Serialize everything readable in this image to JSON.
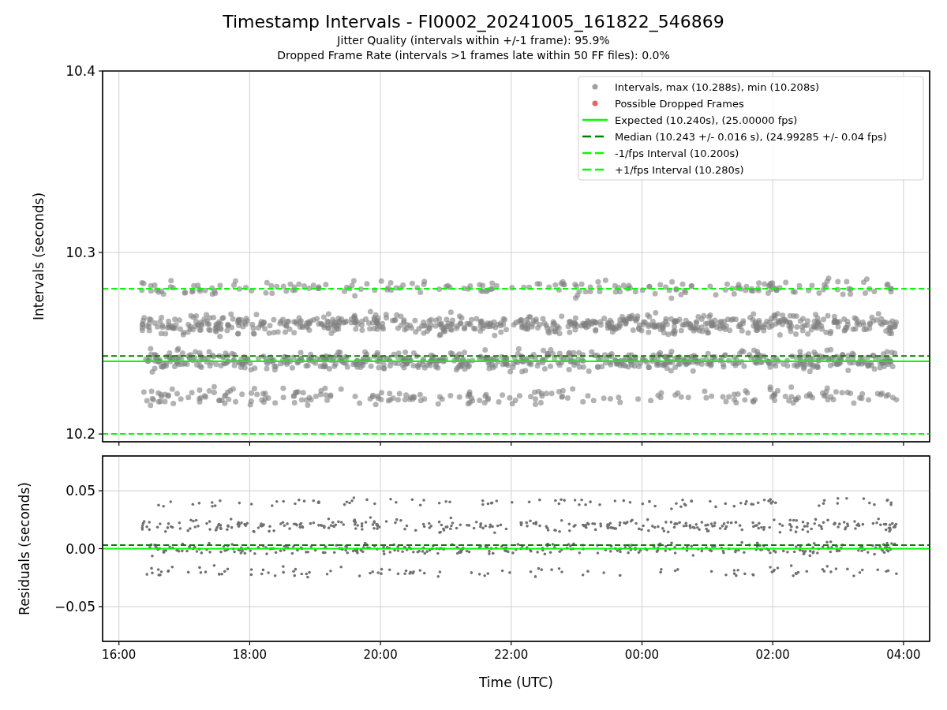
{
  "figure": {
    "title": "Timestamp Intervals - FI0002_20241005_161822_546869",
    "subtitles": [
      "Jitter Quality (intervals within +/-1 frame): 95.9%",
      "Dropped Frame Rate (intervals >1 frames late within 50 FF files): 0.0%"
    ]
  },
  "intervals_plot": {
    "marker_legend": [
      {
        "color": "#a0a0a0",
        "label": "Intervals, max (10.288s), min (10.208s)"
      },
      {
        "color": "#f06060",
        "label": "Possible Dropped Frames"
      }
    ],
    "chart_data": {
      "type": "line",
      "ylabel": "Intervals (seconds)",
      "grid": true,
      "legend": "upper right",
      "x": [
        "2024-10-05T15:45:00",
        "2024-10-06T04:24:00"
      ],
      "xlim": [
        "2024-10-05T15:45:00",
        "2024-10-06T04:24:00"
      ],
      "ylim": [
        10.1957,
        10.4
      ],
      "yticks": [
        {
          "value": 10.2,
          "label": "10.2"
        },
        {
          "value": 10.3,
          "label": "10.3"
        },
        {
          "value": 10.4,
          "label": "10.4"
        }
      ],
      "series": [
        {
          "name": "Expected (10.240s), (25.00000 fps)",
          "color": "#00ff00",
          "line_style": "solid",
          "values": [
            10.24,
            10.24
          ]
        },
        {
          "name": "Median (10.243 +/- 0.016 s), (24.99285 +/- 0.04 fps)",
          "color": "#008000",
          "line_style": "dashed",
          "values": [
            10.243,
            10.243
          ]
        },
        {
          "name": "-1/fps Interval (10.200s)",
          "color": "#00ff00",
          "line_style": "dashed",
          "values": [
            10.2,
            10.2
          ]
        },
        {
          "name": "+1/fps Interval (10.280s)",
          "color": "#00ff00",
          "line_style": "dashed",
          "values": [
            10.28,
            10.28
          ]
        }
      ]
    }
  },
  "residuals_plot": {
    "chart_data": {
      "type": "line",
      "xlabel": "Time (UTC)",
      "ylabel": "Residuals (seconds)",
      "grid": true,
      "x": [
        "2024-10-05T15:45:00",
        "2024-10-06T04:24:00"
      ],
      "xlim": [
        "2024-10-05T15:45:00",
        "2024-10-06T04:24:00"
      ],
      "ylim": [
        -0.08,
        0.08
      ],
      "xticks": [
        {
          "value": "2024-10-05T16:00:00",
          "label": "16:00"
        },
        {
          "value": "2024-10-05T18:00:00",
          "label": "18:00"
        },
        {
          "value": "2024-10-05T20:00:00",
          "label": "20:00"
        },
        {
          "value": "2024-10-05T22:00:00",
          "label": "22:00"
        },
        {
          "value": "2024-10-06T00:00:00",
          "label": "00:00"
        },
        {
          "value": "2024-10-06T02:00:00",
          "label": "02:00"
        },
        {
          "value": "2024-10-06T04:00:00",
          "label": "04:00"
        }
      ],
      "yticks": [
        {
          "value": -0.05,
          "label": "−0.05"
        },
        {
          "value": 0,
          "label": "0.00"
        },
        {
          "value": 0.05,
          "label": "0.05"
        }
      ],
      "series": [
        {
          "color": "#00ff00",
          "line_style": "solid",
          "values": [
            0,
            0
          ]
        },
        {
          "color": "#008000",
          "line_style": "dashed",
          "values": [
            0.003,
            0.003
          ]
        }
      ]
    }
  }
}
